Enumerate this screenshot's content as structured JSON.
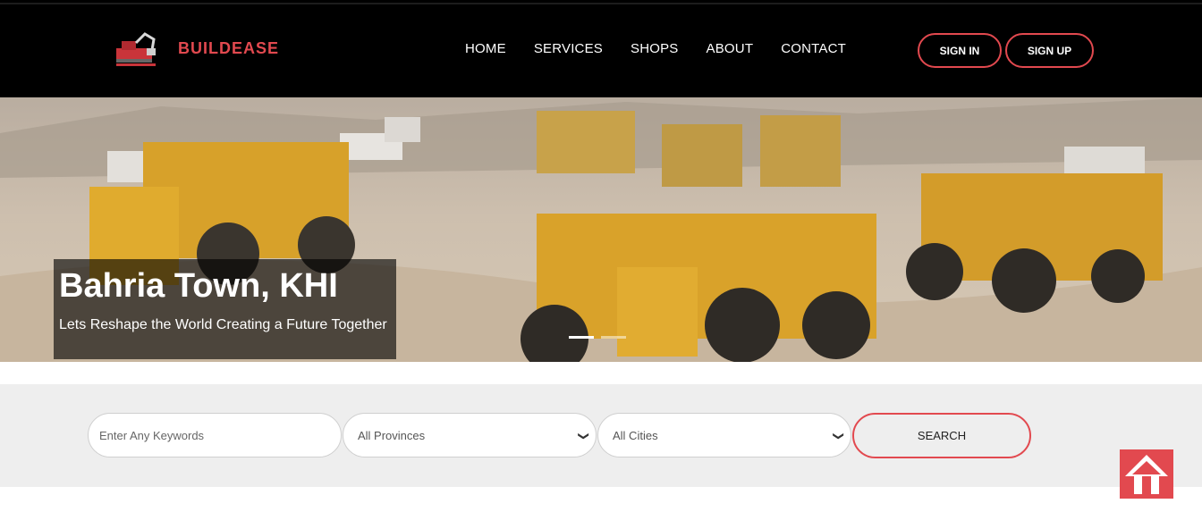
{
  "brand": {
    "name": "BUILDEASE",
    "logo_icon": "excavator-logo-icon",
    "accent": "#e2494f"
  },
  "nav": {
    "items": [
      "HOME",
      "SERVICES",
      "SHOPS",
      "ABOUT",
      "CONTACT"
    ]
  },
  "auth": {
    "signin_label": "SIGN IN",
    "signup_label": "SIGN UP"
  },
  "hero": {
    "title": "Bahria Town, KHI",
    "subtitle": "Lets Reshape the World Creating a Future Together",
    "image_icon": "construction-site-photo",
    "slides": 2,
    "active_slide": 1
  },
  "search": {
    "keyword_placeholder": "Enter Any Keywords",
    "province_value": "All Provinces",
    "city_value": "All Cities",
    "button_label": "SEARCH"
  },
  "scroll_top": {
    "icon": "arrow-up-icon"
  }
}
